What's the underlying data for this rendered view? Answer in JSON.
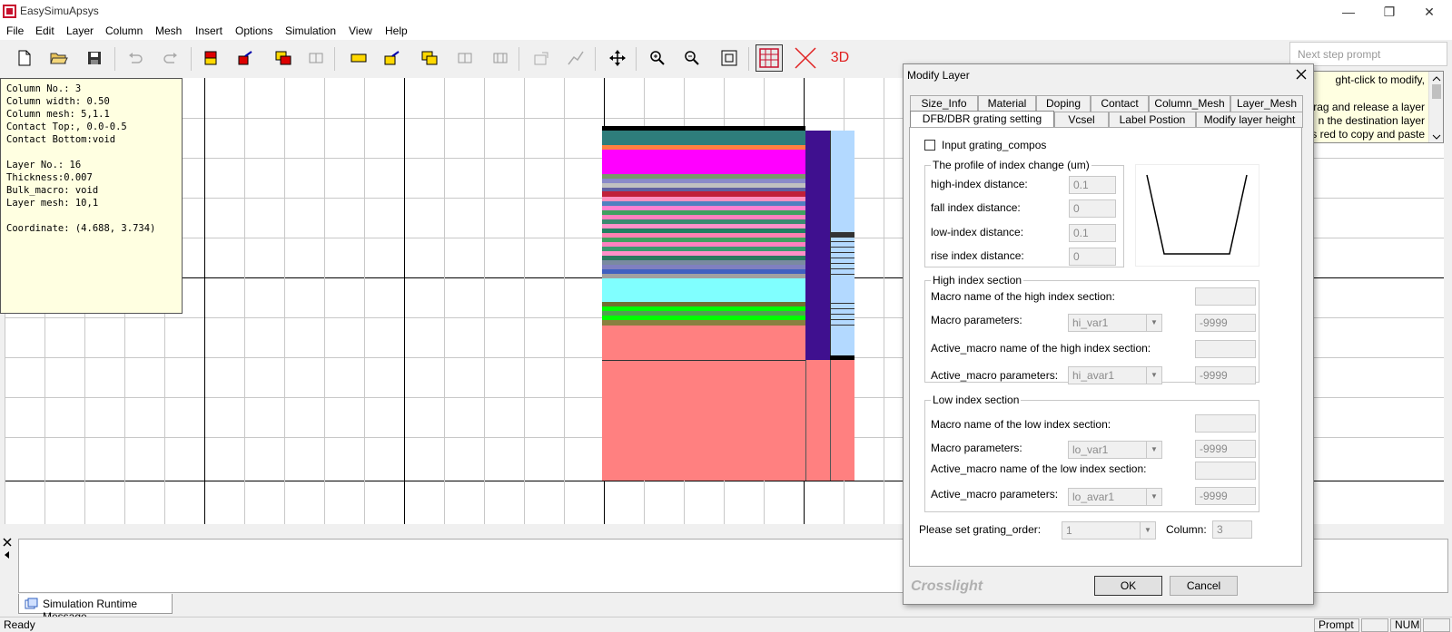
{
  "window": {
    "title": "EasySimuApsys",
    "minimize": "—",
    "restore": "❐",
    "close": "✕"
  },
  "menu": [
    "File",
    "Edit",
    "Layer",
    "Column",
    "Mesh",
    "Insert",
    "Options",
    "Simulation",
    "View",
    "Help"
  ],
  "toolbar": {
    "label_3d": "3D",
    "next_step_prompt": "Next step prompt"
  },
  "info": {
    "text": "Column No.: 3\nColumn width: 0.50\nColumn mesh: 5,1.1\nContact Top:, 0.0-0.5\nContact Bottom:void\n\nLayer No.: 16\nThickness:0.007\nBulk_macro: void\nLayer mesh: 10,1\n\nCoordinate: (4.688, 3.734)"
  },
  "prompt_lines": [
    "ght-click to modify,",
    "",
    "rag and release a layer",
    "n the destination layer",
    "s red to copy and paste"
  ],
  "messages": {
    "tab_label": "Simulation Runtime Message"
  },
  "status": {
    "ready": "Ready",
    "prompt": "Prompt",
    "num": "NUM"
  },
  "dialog": {
    "title": "Modify Layer",
    "tabs_row1": [
      "Size_Info",
      "Material",
      "Doping",
      "Contact",
      "Column_Mesh",
      "Layer_Mesh"
    ],
    "tabs_row2": [
      "DFB/DBR grating setting",
      "Vcsel",
      "Label Postion",
      "Modify layer height"
    ],
    "input_grating_label": "Input grating_compos",
    "profile": {
      "title": "The profile of index change (um)",
      "high_label": "high-index distance:",
      "high_value": "0.1",
      "fall_label": "fall index distance:",
      "fall_value": "0",
      "low_label": "low-index distance:",
      "low_value": "0.1",
      "rise_label": "rise index distance:",
      "rise_value": "0"
    },
    "high": {
      "title": "High index section",
      "macro_name_label": "Macro name of the high index section:",
      "macro_name_value": "",
      "macro_params_label": "Macro parameters:",
      "macro_combo": "hi_var1",
      "macro_value": "-9999",
      "active_name_label": "Active_macro name of the high index section:",
      "active_name_value": "",
      "active_params_label": "Active_macro parameters:",
      "active_combo": "hi_avar1",
      "active_value": "-9999"
    },
    "low": {
      "title": "Low index section",
      "macro_name_label": "Macro name of the low index section:",
      "macro_name_value": "",
      "macro_params_label": "Macro parameters:",
      "macro_combo": "lo_var1",
      "macro_value": "-9999",
      "active_name_label": "Active_macro name of the low index section:",
      "active_name_value": "",
      "active_params_label": "Active_macro parameters:",
      "active_combo": "lo_avar1",
      "active_value": "-9999"
    },
    "grating_order_label": "Please set grating_order:",
    "grating_order_value": "1",
    "column_label": "Column:",
    "column_value": "3",
    "brand": "Crosslight",
    "ok": "OK",
    "cancel": "Cancel"
  },
  "colors": {
    "teal": "#2e7d7b",
    "magenta": "#ff00ff",
    "cyan": "#80ffff",
    "green": "#00ff00",
    "salmon": "#ff8080",
    "purple": "#3f108f",
    "lightblue": "#b3d9ff",
    "crimson": "#c8102e"
  }
}
